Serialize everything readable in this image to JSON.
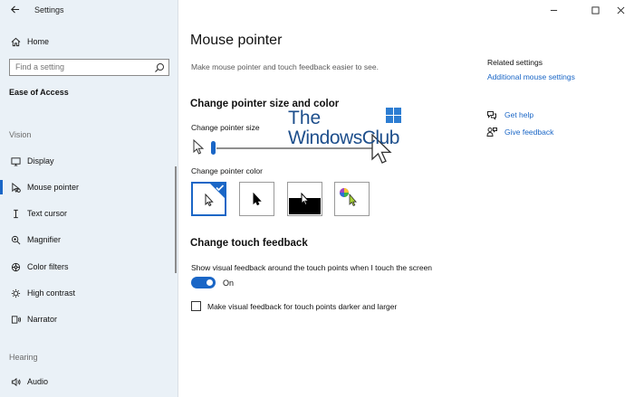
{
  "window": {
    "title": "Settings",
    "controls": [
      "minimize",
      "maximize",
      "close"
    ]
  },
  "sidebar": {
    "home_label": "Home",
    "search_placeholder": "Find a setting",
    "group_title": "Ease of Access",
    "sections": [
      {
        "title": "Vision"
      },
      {
        "title": "Hearing"
      }
    ],
    "items": [
      {
        "label": "Display",
        "icon": "monitor-icon",
        "selected": false
      },
      {
        "label": "Mouse pointer",
        "icon": "mouse-pointer-icon",
        "selected": true
      },
      {
        "label": "Text cursor",
        "icon": "text-cursor-icon",
        "selected": false
      },
      {
        "label": "Magnifier",
        "icon": "magnifier-icon",
        "selected": false
      },
      {
        "label": "Color filters",
        "icon": "color-filter-icon",
        "selected": false
      },
      {
        "label": "High contrast",
        "icon": "high-contrast-icon",
        "selected": false
      },
      {
        "label": "Narrator",
        "icon": "narrator-icon",
        "selected": false
      },
      {
        "label": "Audio",
        "icon": "audio-icon",
        "selected": false
      }
    ]
  },
  "main": {
    "title": "Mouse pointer",
    "description": "Make mouse pointer and touch feedback easier to see.",
    "pointer_section_title": "Change pointer size and color",
    "size_label": "Change pointer size",
    "size_value": 1,
    "color_label": "Change pointer color",
    "color_options": [
      {
        "name": "white",
        "selected": true
      },
      {
        "name": "black",
        "selected": false
      },
      {
        "name": "inverted",
        "selected": false
      },
      {
        "name": "custom",
        "selected": false
      }
    ],
    "touch_section_title": "Change touch feedback",
    "touch_feedback_label": "Show visual feedback around the touch points when I touch the screen",
    "toggle_state": "On",
    "darker_checkbox_label": "Make visual feedback for touch points darker and larger",
    "darker_checked": false
  },
  "related": {
    "title": "Related settings",
    "additional_link": "Additional mouse settings",
    "help_link": "Get help",
    "feedback_link": "Give feedback"
  },
  "watermark": {
    "line1": "The",
    "line2": "WindowsClub"
  },
  "colors": {
    "accent": "#1a66c6",
    "sidebar_bg": "#eaf1f7",
    "watermark": "#1e4f8c"
  }
}
